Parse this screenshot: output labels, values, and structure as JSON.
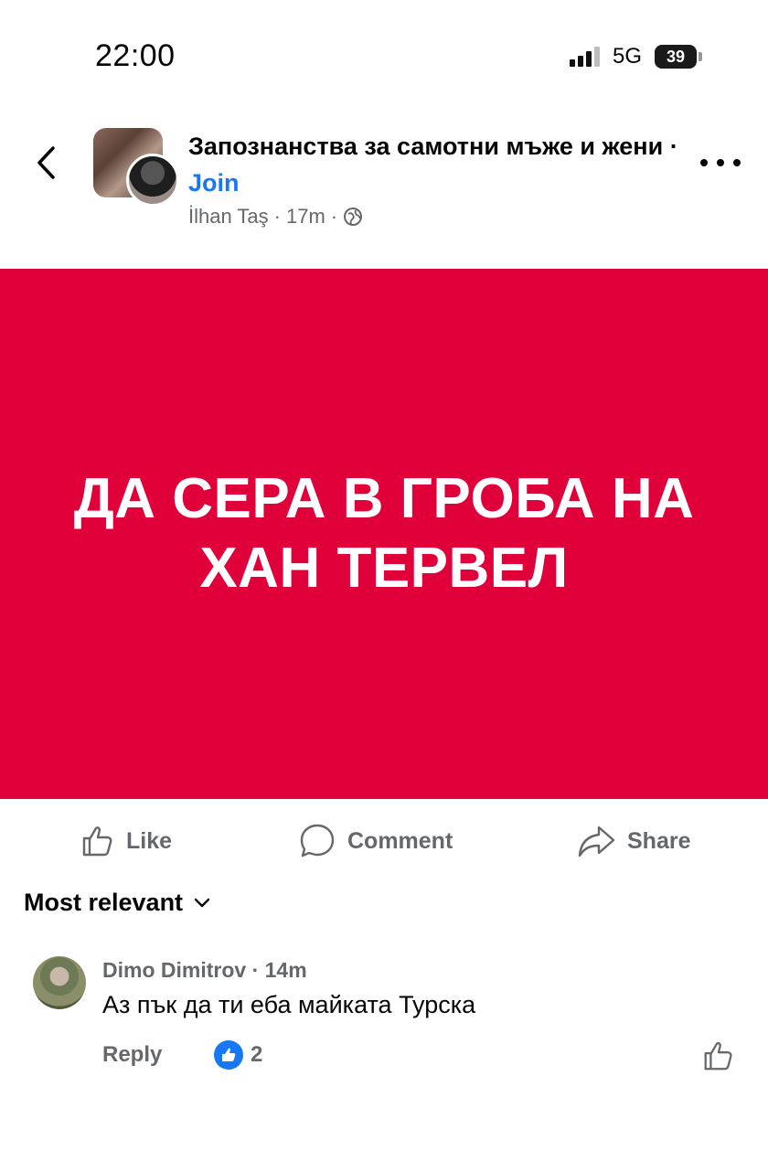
{
  "status_bar": {
    "time": "22:00",
    "network": "5G",
    "battery": "39"
  },
  "post": {
    "group_name": "Запознанства за самотни мъже и жени",
    "separator": " · ",
    "join_label": "Join",
    "author": "İlhan Taş",
    "time_ago": "17m",
    "meta_dot": "·",
    "image_text_line1": "ДА СЕРА В ГРОБА НА",
    "image_text_line2": "ХАН ТЕРВЕЛ",
    "image_bg_color": "#e0003a"
  },
  "actions": {
    "like_label": "Like",
    "comment_label": "Comment",
    "share_label": "Share"
  },
  "comments": {
    "sort_label": "Most relevant",
    "items": [
      {
        "name": "Dimo Dimitrov",
        "time": "14m",
        "text": "Аз пък да ти еба майката Турска",
        "reply_label": "Reply",
        "like_count": "2"
      }
    ]
  },
  "colors": {
    "accent": "#1877f2",
    "muted_text": "#65676b"
  }
}
